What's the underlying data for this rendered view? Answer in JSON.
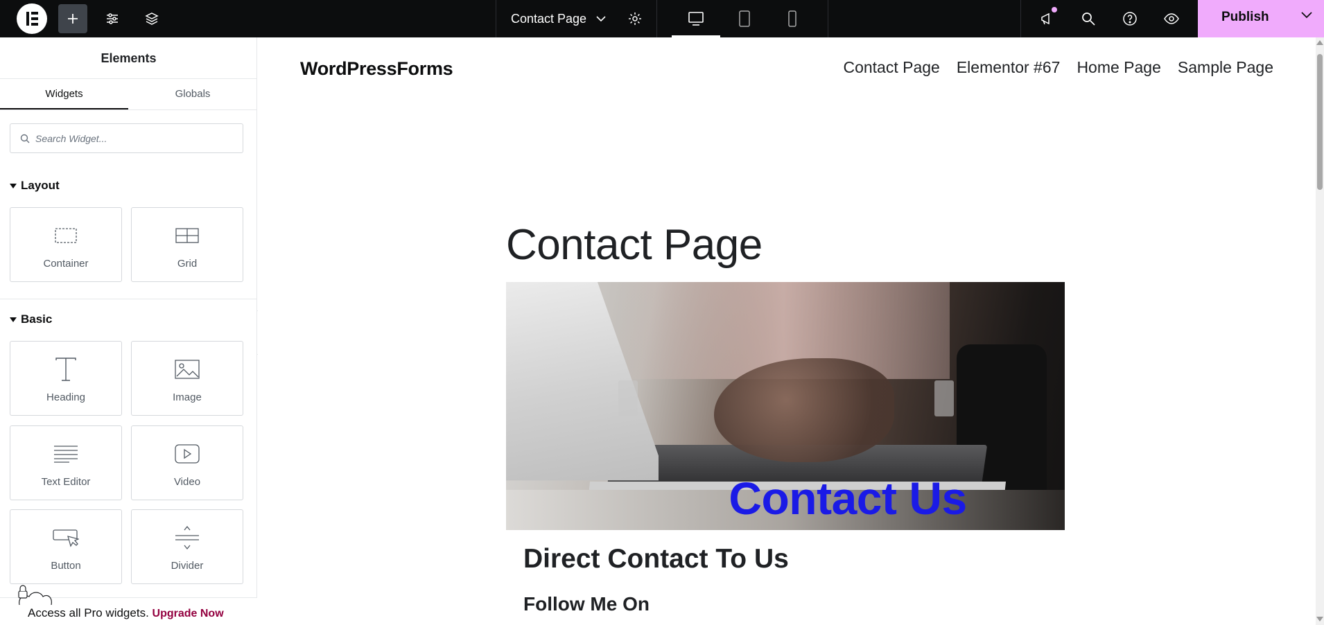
{
  "topbar": {
    "document_title": "Contact Page",
    "publish_label": "Publish",
    "icons": [
      "elementor-logo-icon",
      "add-element-icon",
      "site-settings-icon",
      "structure-layers-icon",
      "chevron-down-icon",
      "page-settings-gear-icon",
      "desktop-icon",
      "tablet-icon",
      "mobile-icon",
      "whats-new-megaphone-icon",
      "search-icon",
      "help-icon",
      "preview-eye-icon",
      "publish-chevron-icon"
    ],
    "publish_color": "#f0abfc"
  },
  "panel": {
    "title": "Elements",
    "tabs": [
      {
        "label": "Widgets"
      },
      {
        "label": "Globals"
      }
    ],
    "search_placeholder": "Search Widget...",
    "sections": [
      {
        "title": "Layout",
        "widgets": [
          {
            "label": "Container"
          },
          {
            "label": "Grid"
          }
        ]
      },
      {
        "title": "Basic",
        "widgets": [
          {
            "label": "Heading"
          },
          {
            "label": "Image"
          },
          {
            "label": "Text Editor"
          },
          {
            "label": "Video"
          },
          {
            "label": "Button"
          },
          {
            "label": "Divider"
          }
        ]
      }
    ],
    "promo_text": "Access all Pro widgets.",
    "promo_link": "Upgrade Now"
  },
  "canvas": {
    "site_title": "WordPressForms",
    "nav": [
      "Contact Page",
      "Elementor #67",
      "Home Page",
      "Sample Page"
    ],
    "page_title": "Contact Page",
    "hero_heading": "Contact Us",
    "hero_heading_color": "#1a1ae6",
    "heading_2": "Direct Contact To Us",
    "heading_3": "Follow Me On"
  }
}
